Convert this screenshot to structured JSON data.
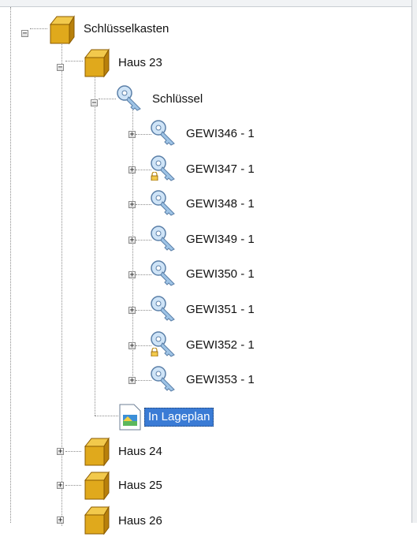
{
  "tree": {
    "root": {
      "label": "Schlüsselkasten",
      "icon": "box-icon",
      "expanded": true
    },
    "haus23": {
      "label": "Haus 23",
      "icon": "box-icon",
      "expanded": true
    },
    "schluessel_group": {
      "label": "Schlüssel",
      "icon": "key-icon",
      "expanded": true
    },
    "keys": [
      {
        "label": "GEWI346 - 1",
        "icon": "key-icon",
        "locked": false
      },
      {
        "label": "GEWI347 - 1",
        "icon": "key-icon",
        "locked": true
      },
      {
        "label": "GEWI348 - 1",
        "icon": "key-icon",
        "locked": false
      },
      {
        "label": "GEWI349 - 1",
        "icon": "key-icon",
        "locked": false
      },
      {
        "label": "GEWI350 - 1",
        "icon": "key-icon",
        "locked": false
      },
      {
        "label": "GEWI351 - 1",
        "icon": "key-icon",
        "locked": false
      },
      {
        "label": "GEWI352 - 1",
        "icon": "key-icon",
        "locked": true
      },
      {
        "label": "GEWI353 - 1",
        "icon": "key-icon",
        "locked": false
      }
    ],
    "lageplan": {
      "label": "In Lageplan",
      "icon": "document-icon",
      "selected": true
    },
    "haus24": {
      "label": "Haus 24",
      "icon": "box-icon",
      "expanded": false
    },
    "haus25": {
      "label": "Haus 25",
      "icon": "box-icon",
      "expanded": false
    },
    "haus26": {
      "label": "Haus 26",
      "icon": "box-icon",
      "expanded": false
    }
  },
  "colors": {
    "selection": "#3a7bd5",
    "box": "#e0a91c",
    "key": "#9fc4e6"
  }
}
